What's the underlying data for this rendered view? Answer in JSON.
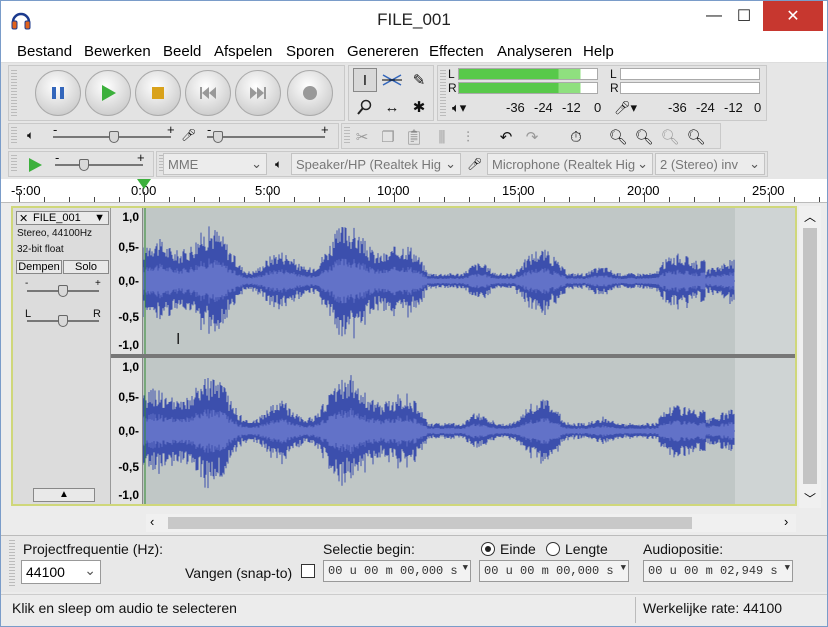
{
  "window": {
    "title": "FILE_001",
    "minimize": "—",
    "maximize": "☐",
    "close": "✕"
  },
  "menu": [
    "Bestand",
    "Bewerken",
    "Beeld",
    "Afspelen",
    "Sporen",
    "Genereren",
    "Effecten",
    "Analyseren",
    "Help"
  ],
  "meters": {
    "playback_scale": [
      "-36",
      "-24",
      "-12",
      "0"
    ],
    "record_scale": [
      "-36",
      "-24",
      "-12",
      "0"
    ],
    "channel_left": "L",
    "channel_right": "R"
  },
  "device": {
    "host": "MME",
    "output": "Speaker/HP (Realtek Hig",
    "input": "Microphone (Realtek Hig",
    "channels": "2 (Stereo) inv"
  },
  "ruler": {
    "labels": [
      "-5:00",
      "0:00",
      "5:00",
      "10:00",
      "15:00",
      "20:00",
      "25:00"
    ]
  },
  "track": {
    "name": "FILE_001",
    "info_rate": "Stereo, 44100Hz",
    "info_format": "32-bit float",
    "mute_label": "Dempen",
    "solo_label": "Solo",
    "gain_minus": "-",
    "gain_plus": "+",
    "pan_left": "L",
    "pan_right": "R",
    "scale": [
      "1,0",
      "0,5-",
      "0,0-",
      "-0,5",
      "-1,0"
    ]
  },
  "selection": {
    "project_rate_label": "Projectfrequentie (Hz):",
    "project_rate": "44100",
    "snap_label": "Vangen (snap-to)",
    "sel_start_label": "Selectie begin:",
    "sel_start": "00 u 00 m 00,000 s",
    "end_label": "Einde",
    "length_label": "Lengte",
    "sel_end": "00 u 00 m 00,000 s",
    "audio_pos_label": "Audiopositie:",
    "audio_pos": "00 u 00 m 02,949 s"
  },
  "status": {
    "hint": "Klik en sleep om audio te selecteren",
    "rate": "Werkelijke rate: 44100"
  },
  "colors": {
    "waveform": "#3c4fad",
    "waveform_rms": "#6272c8",
    "track_bg": "#c0c7c6",
    "meter_green": "#58c94a",
    "close": "#c7372f"
  }
}
